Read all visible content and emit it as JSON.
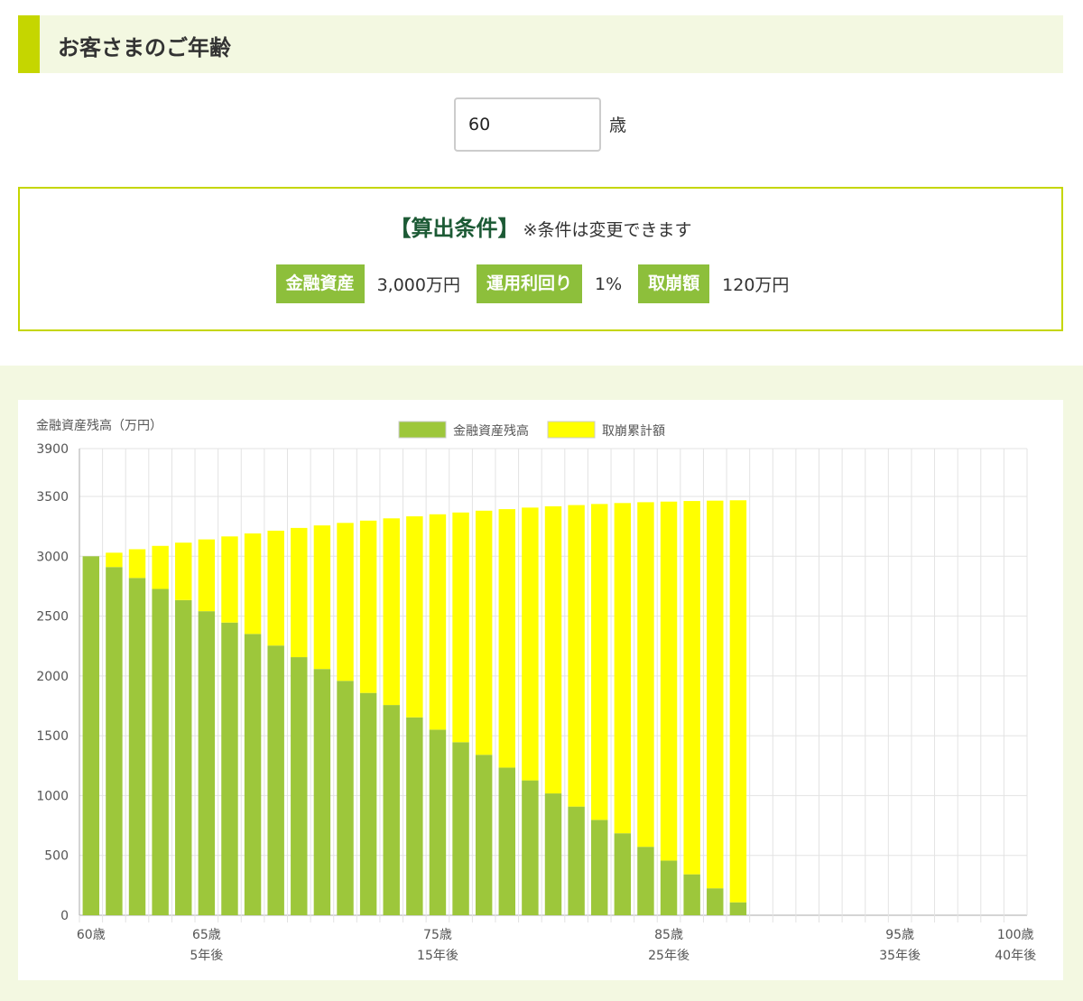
{
  "section": {
    "title": "お客さまのご年齢"
  },
  "age_input": {
    "value": "60",
    "unit": "歳"
  },
  "conditions": {
    "title": "【算出条件】",
    "note": "※条件は変更できます",
    "items": [
      {
        "label": "金融資産",
        "value": "3,000万円"
      },
      {
        "label": "運用利回り",
        "value": "1%"
      },
      {
        "label": "取崩額",
        "value": "120万円"
      }
    ]
  },
  "colors": {
    "accent": "#c5d600",
    "badge": "#8dbf3b",
    "title_green": "#1c5a35",
    "bg_light": "#f3f8e1"
  },
  "chart_data": {
    "type": "bar",
    "stacked": true,
    "ylabel": "金融資産残高（万円）",
    "ylim": [
      0,
      3900
    ],
    "yticks": [
      0,
      500,
      1000,
      1500,
      2000,
      2500,
      3000,
      3500,
      3900
    ],
    "grid": true,
    "legend_position": "top-center",
    "x_count": 41,
    "x_tick_labels": [
      {
        "index": 0,
        "age": "60歳",
        "years": ""
      },
      {
        "index": 5,
        "age": "65歳",
        "years": "5年後"
      },
      {
        "index": 15,
        "age": "75歳",
        "years": "15年後"
      },
      {
        "index": 25,
        "age": "85歳",
        "years": "25年後"
      },
      {
        "index": 35,
        "age": "95歳",
        "years": "35年後"
      },
      {
        "index": 40,
        "age": "100歳",
        "years": "40年後"
      }
    ],
    "series": [
      {
        "name": "金融資産残高",
        "color": "#9dc73b",
        "values": [
          3000,
          2910,
          2819,
          2727,
          2634,
          2541,
          2446,
          2351,
          2254,
          2157,
          2058,
          1959,
          1858,
          1757,
          1654,
          1551,
          1446,
          1341,
          1234,
          1127,
          1018,
          908,
          797,
          685,
          572,
          457,
          342,
          225,
          108
        ]
      },
      {
        "name": "取崩累計額",
        "color": "#ffff00",
        "values": [
          0,
          120,
          240,
          360,
          480,
          600,
          720,
          840,
          960,
          1080,
          1200,
          1320,
          1440,
          1560,
          1680,
          1800,
          1920,
          2040,
          2160,
          2280,
          2400,
          2520,
          2640,
          2760,
          2880,
          3000,
          3120,
          3240,
          3360
        ]
      }
    ]
  }
}
